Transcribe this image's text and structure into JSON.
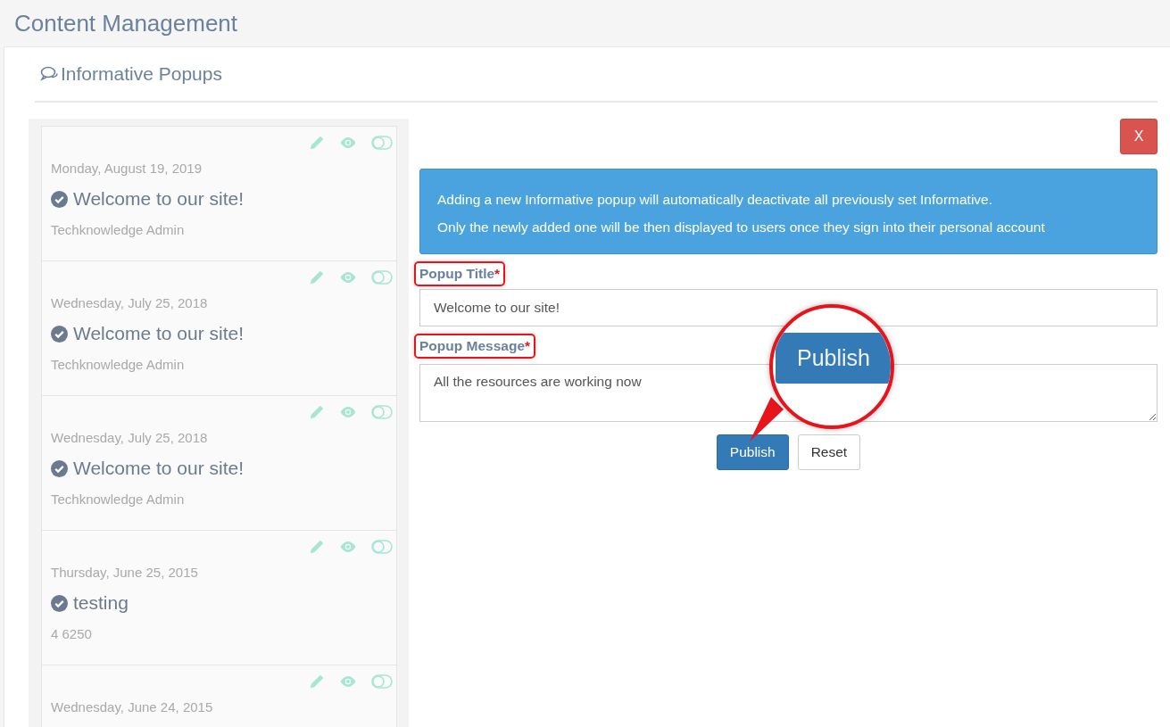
{
  "header": {
    "title": "Content Management"
  },
  "section": {
    "title": "Informative Popups"
  },
  "popups": [
    {
      "date": "Monday, August 19, 2019",
      "title": "Welcome to our site!",
      "author": "Techknowledge Admin",
      "active": true
    },
    {
      "date": "Wednesday, July 25, 2018",
      "title": "Welcome to our site!",
      "author": "Techknowledge Admin",
      "active": true
    },
    {
      "date": "Wednesday, July 25, 2018",
      "title": "Welcome to our site!",
      "author": "Techknowledge Admin",
      "active": true
    },
    {
      "date": "Thursday, June 25, 2015",
      "title": "testing",
      "author": "4 6250",
      "active": true
    },
    {
      "date": "Wednesday, June 24, 2015"
    }
  ],
  "close_button": "X",
  "notice": [
    "Adding a new Informative popup will automatically deactivate all previously set Informative.",
    "Only the newly added one will be then displayed to users once they sign into their personal account"
  ],
  "form": {
    "fields": [
      {
        "kind": "input",
        "label": "Popup Title",
        "required_mark": "*",
        "value": "Welcome to our site!",
        "highlighted": true
      },
      {
        "kind": "textarea",
        "label": "Popup Message",
        "required_mark": "*",
        "value": "All the resources are working now",
        "highlighted": true
      }
    ],
    "buttons": [
      {
        "label": "Publish",
        "kind": "primary"
      },
      {
        "label": "Reset",
        "kind": "default"
      }
    ]
  },
  "callout": {
    "text": "Publish"
  }
}
